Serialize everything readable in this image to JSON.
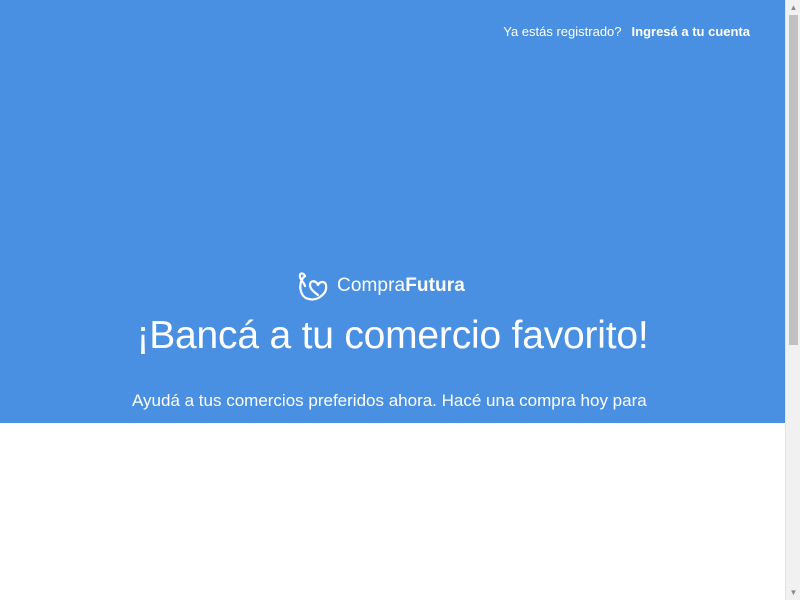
{
  "header": {
    "registered_text": "Ya estás registrado?",
    "login_link": "Ingresá a tu cuenta"
  },
  "brand": {
    "name_light": "Compra",
    "name_bold": "Futura",
    "icon": "hand-heart-icon"
  },
  "hero": {
    "title": "¡Bancá a tu comercio favorito!",
    "description": "Ayudá a tus comercios preferidos ahora. Hacé una compra hoy para"
  },
  "colors": {
    "hero_background": "#4a90e2",
    "text": "#ffffff",
    "page_background": "#ffffff",
    "scrollbar_track": "#f1f1f1",
    "scrollbar_thumb": "#c1c1c1"
  },
  "scrollbar": {
    "up_icon": "scroll-up-icon",
    "down_icon": "scroll-down-icon"
  }
}
